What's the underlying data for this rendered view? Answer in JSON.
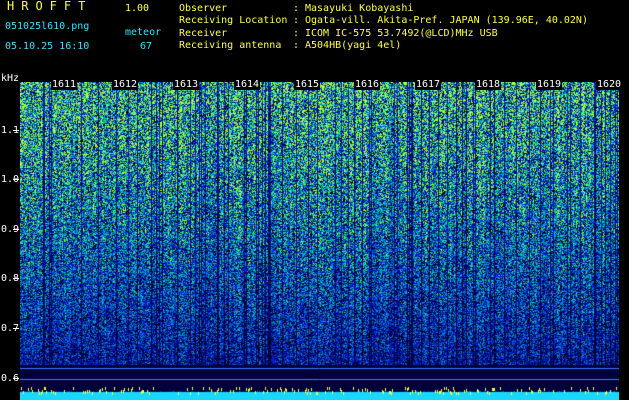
{
  "app": {
    "title": "HROFFT",
    "version": "1.00"
  },
  "file": {
    "name": "051025l610.png",
    "datetime": "05.10.25 16:10"
  },
  "meteor": {
    "label": "meteor",
    "count": "67"
  },
  "info": [
    {
      "label": "Observer",
      "value": "Masayuki Kobayashi"
    },
    {
      "label": "Receiving Location",
      "value": "Ogata-vill. Akita-Pref. JAPAN (139.96E, 40.02N)"
    },
    {
      "label": "Receiver",
      "value": "ICOM IC-575 53.7492(@LCD)MHz USB"
    },
    {
      "label": "Receiving antenna",
      "value": "A504HB(yagi 4el)"
    }
  ],
  "axis": {
    "unit": "kHz",
    "y_labels": [
      "1.1",
      "1.0",
      "0.9",
      "0.8",
      "0.7",
      "0.6"
    ],
    "time_labels": [
      "1611",
      "1612",
      "1613",
      "1614",
      "1615",
      "1616",
      "1617",
      "1618",
      "1619",
      "1620"
    ]
  },
  "colors": {
    "yellow": "#ffff3c",
    "cyan": "#39e0ff",
    "background": "#000000"
  }
}
